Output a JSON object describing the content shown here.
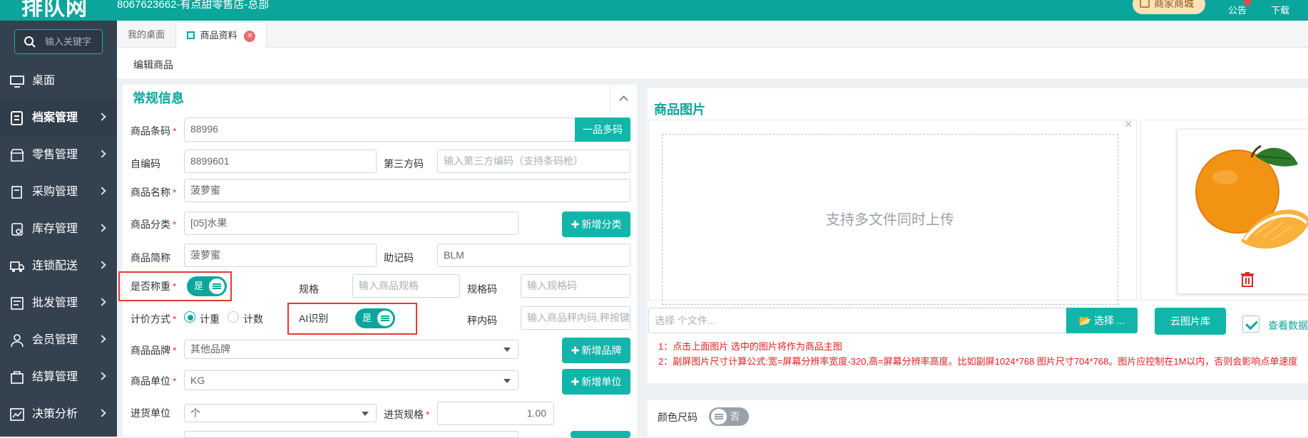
{
  "header": {
    "logo": "排队网",
    "store": "8067623662-有点甜零售店-总部",
    "mall": "商家商城",
    "notice": "公告",
    "download": "下载"
  },
  "sidebar": {
    "search_placeholder": "输入关键字",
    "items": [
      {
        "label": "桌面",
        "icon": "monitor-icon"
      },
      {
        "label": "档案管理",
        "icon": "archive-icon"
      },
      {
        "label": "零售管理",
        "icon": "store-icon"
      },
      {
        "label": "采购管理",
        "icon": "purchase-icon"
      },
      {
        "label": "库存管理",
        "icon": "inventory-icon"
      },
      {
        "label": "连锁配送",
        "icon": "truck-icon"
      },
      {
        "label": "批发管理",
        "icon": "wholesale-icon"
      },
      {
        "label": "会员管理",
        "icon": "member-icon"
      },
      {
        "label": "结算管理",
        "icon": "settlement-icon"
      },
      {
        "label": "决策分析",
        "icon": "analysis-icon"
      }
    ]
  },
  "tabs": [
    "我的桌面",
    "商品资料"
  ],
  "subheader": "编辑商品",
  "general": {
    "title": "常规信息",
    "barcode_label": "商品条码",
    "barcode_value": "88996",
    "multi_code_button": "一品多码",
    "selfcode_label": "自编码",
    "selfcode_value": "8899601",
    "thirdparty_label": "第三方码",
    "thirdparty_placeholder": "输入第三方编码（支持条码枪）",
    "name_label": "商品名称",
    "name_value": "菠萝蜜",
    "category_label": "商品分类",
    "category_value": "[05]水果",
    "add_category_button": "新增分类",
    "short_label": "商品简称",
    "short_value": "菠萝蜜",
    "mnemonic_label": "助记码",
    "mnemonic_value": "BLM",
    "weigh_label": "是否称重",
    "weigh_toggle": "是",
    "spec_label": "规格",
    "spec_placeholder": "输入商品规格",
    "speccode_label": "规格码",
    "speccode_placeholder": "输入规格码",
    "pricing_label": "计价方式",
    "pricing_options": [
      "计重",
      "计数"
    ],
    "ai_label": "AI识别",
    "ai_toggle": "是",
    "scalecode_label": "秤内码",
    "scalecode_placeholder": "输入商品秤内码,秤按键",
    "brand_label": "商品品牌",
    "brand_value": "其他品牌",
    "add_brand_button": "新增品牌",
    "unit_label": "商品单位",
    "unit_value": "KG",
    "add_unit_button": "新增单位",
    "purchase_unit_label": "进货单位",
    "purchase_unit_value": "个",
    "purchase_spec_label": "进货规格",
    "purchase_spec_value": "1.00"
  },
  "images": {
    "title": "商品图片",
    "upload_hint": "支持多文件同时上传",
    "file_placeholder": "选择 个文件...",
    "choose_button": "选择 ...",
    "cloud_button": "云图片库",
    "view_data": "查看数据",
    "note1": "1：点击上面图片 选中的图片将作为商品主图",
    "note2": "2：副屏图片尺寸计算公式:宽=屏幕分辨率宽度-320,高=屏幕分辨率高度。比如副屏1024*768 图片尺寸704*768。图片应控制在1M以内，否则会影响点单速度"
  },
  "color_size": {
    "label": "颜色尺码",
    "toggle": "否"
  },
  "colors": {
    "accent": "#0aa59b",
    "sidebar": "#344250",
    "required": "#e43d3d",
    "highlight": "#e53935"
  }
}
